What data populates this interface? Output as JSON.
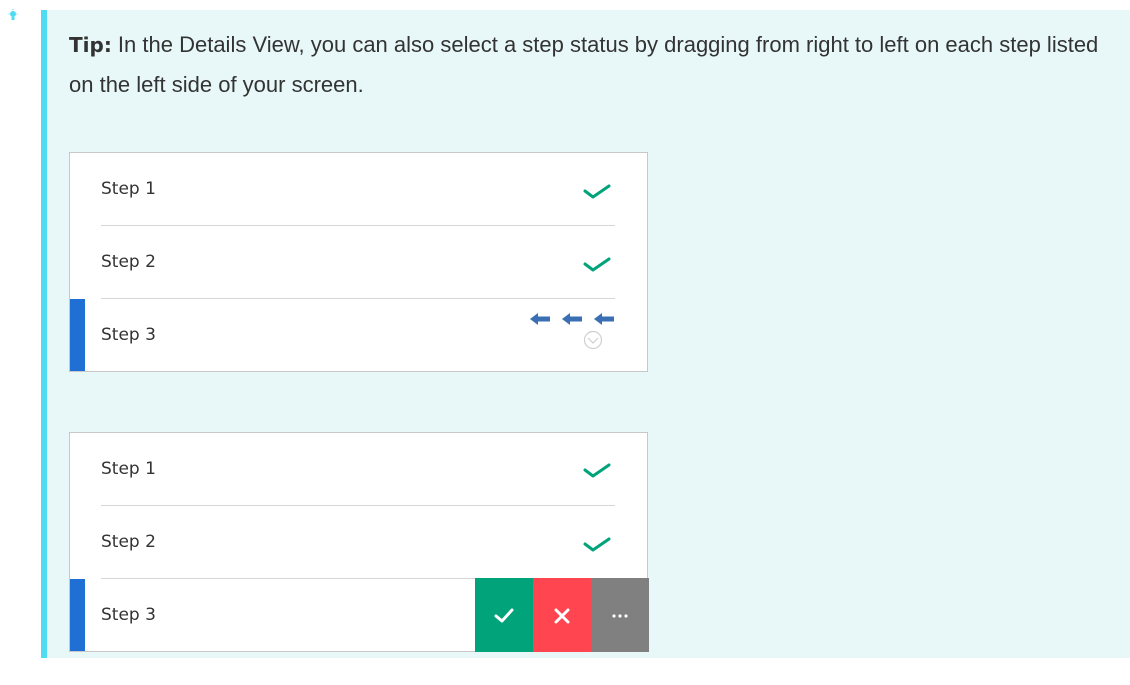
{
  "tip": {
    "heading": "Tip:",
    "body": " In the Details View, you can also select a step status by dragging from right to left on each step listed on the left side of your screen."
  },
  "panels": [
    {
      "steps": [
        {
          "label": "Step 1",
          "status": "passed"
        },
        {
          "label": "Step 2",
          "status": "passed"
        },
        {
          "label": "Step 3",
          "status": "selected-drag-hint"
        }
      ]
    },
    {
      "steps": [
        {
          "label": "Step 1",
          "status": "passed"
        },
        {
          "label": "Step 2",
          "status": "passed"
        },
        {
          "label": "Step 3",
          "status": "selected-actions-revealed"
        }
      ]
    }
  ],
  "actions": [
    {
      "name": "pass",
      "icon": "check-icon",
      "color": "#00a37a"
    },
    {
      "name": "fail",
      "icon": "x-icon",
      "color": "#ff454f"
    },
    {
      "name": "more",
      "icon": "more-icon",
      "color": "#808080"
    }
  ],
  "colors": {
    "callout_background": "#e8f8f8",
    "callout_accent": "#4fdcf2",
    "selection": "#1f6fd4",
    "check": "#00a37a",
    "arrow": "#3a6fb3"
  }
}
